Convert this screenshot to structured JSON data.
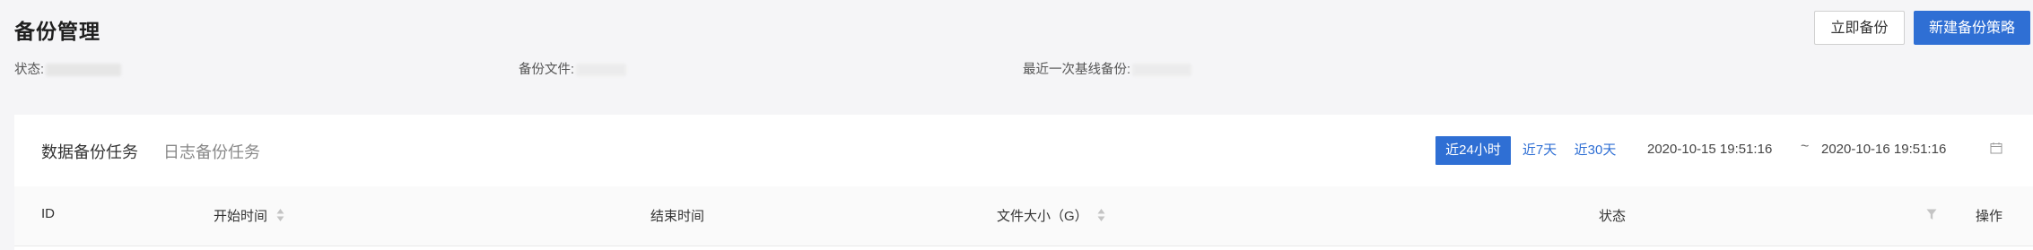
{
  "header": {
    "title": "备份管理",
    "backup_now": "立即备份",
    "new_policy": "新建备份策略"
  },
  "info": {
    "status_label": "状态:",
    "file_label": "备份文件:",
    "baseline_label": "最近一次基线备份:"
  },
  "tabs": [
    {
      "label": "数据备份任务",
      "active": true
    },
    {
      "label": "日志备份任务",
      "active": false
    }
  ],
  "time_range": {
    "options": [
      "近24小时",
      "近7天",
      "近30天"
    ],
    "selected": "近24小时",
    "start": "2020-10-15 19:51:16",
    "separator": "~",
    "end": "2020-10-16 19:51:16"
  },
  "table": {
    "columns": [
      "ID",
      "开始时间",
      "结束时间",
      "文件大小（G）",
      "状态",
      "操作"
    ]
  },
  "colors": {
    "primary": "#2f6fd4",
    "background": "#f5f5f7"
  }
}
